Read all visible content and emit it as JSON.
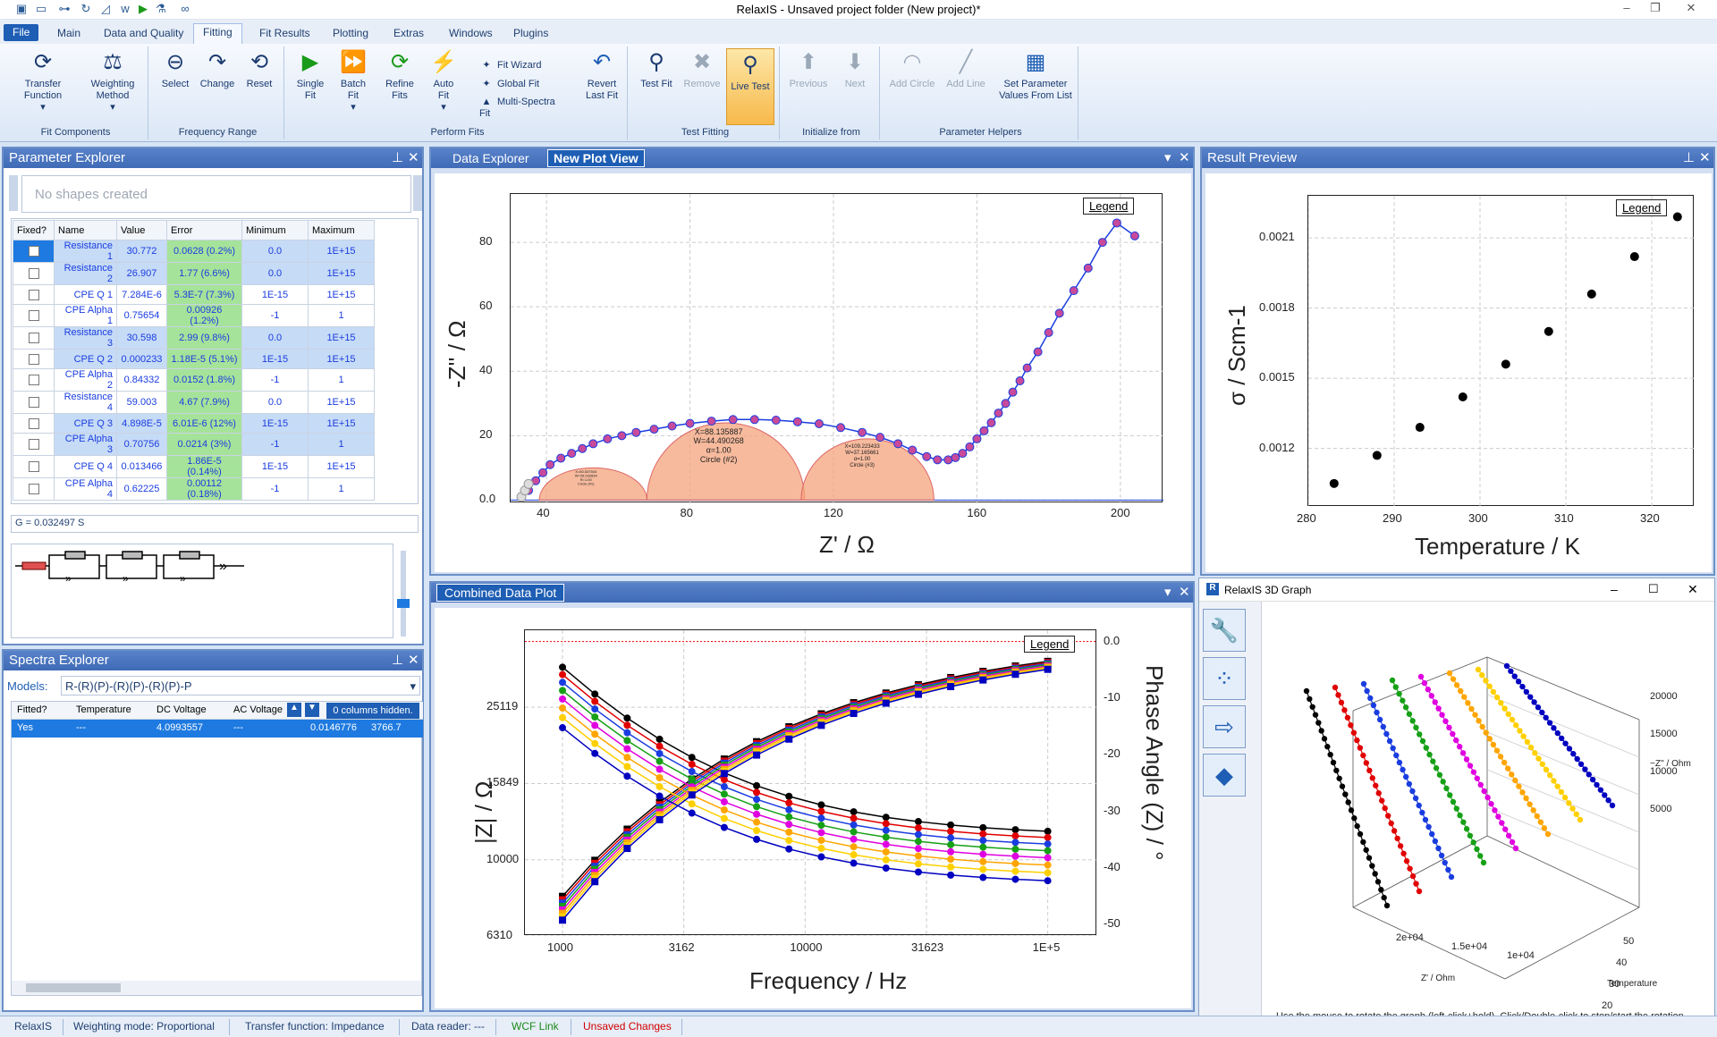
{
  "app": {
    "title": "RelaxIS - Unsaved project folder (New project)*"
  },
  "ribbon": {
    "tabs": [
      "File",
      "Main",
      "Data and Quality",
      "Fitting",
      "Fit Results",
      "Plotting",
      "Extras",
      "Windows",
      "Plugins"
    ],
    "active_tab": "Fitting",
    "groups": {
      "fit_components": {
        "label": "Fit Components",
        "transfer": "Transfer\nFunction",
        "weighting": "Weighting\nMethod"
      },
      "frequency_range": {
        "label": "Frequency Range",
        "select": "Select",
        "change": "Change",
        "reset": "Reset"
      },
      "perform_fits": {
        "label": "Perform Fits",
        "single": "Single\nFit",
        "batch": "Batch\nFit",
        "refine": "Refine\nFits",
        "auto": "Auto\nFit",
        "wizard": "Fit Wizard",
        "global": "Global Fit",
        "multi": "Multi-Spectra\nFit",
        "revert": "Revert\nLast Fit"
      },
      "test_fitting": {
        "label": "Test Fitting",
        "test": "Test Fit",
        "remove": "Remove",
        "live": "Live Test"
      },
      "initialize": {
        "label": "Initialize from",
        "previous": "Previous",
        "next": "Next"
      },
      "helpers": {
        "label": "Parameter Helpers",
        "circle": "Add Circle",
        "line": "Add Line",
        "setparam": "Set Parameter\nValues From List"
      }
    }
  },
  "param_explorer": {
    "title": "Parameter Explorer",
    "shapes_placeholder": "No shapes created",
    "columns": [
      "Fixed?",
      "Name",
      "Value",
      "Error",
      "Minimum",
      "Maximum"
    ],
    "rows": [
      {
        "name": "Resistance 1",
        "value": "30.772",
        "error": "0.0628 (0.2%)",
        "min": "0.0",
        "max": "1E+15"
      },
      {
        "name": "Resistance 2",
        "value": "26.907",
        "error": "1.77 (6.6%)",
        "min": "0.0",
        "max": "1E+15"
      },
      {
        "name": "CPE Q 1",
        "value": "7.284E-6",
        "error": "5.3E-7 (7.3%)",
        "min": "1E-15",
        "max": "1E+15"
      },
      {
        "name": "CPE Alpha 1",
        "value": "0.75654",
        "error": "0.00926 (1.2%)",
        "min": "-1",
        "max": "1"
      },
      {
        "name": "Resistance 3",
        "value": "30.598",
        "error": "2.99 (9.8%)",
        "min": "0.0",
        "max": "1E+15"
      },
      {
        "name": "CPE Q 2",
        "value": "0.000233",
        "error": "1.18E-5 (5.1%)",
        "min": "1E-15",
        "max": "1E+15"
      },
      {
        "name": "CPE Alpha 2",
        "value": "0.84332",
        "error": "0.0152 (1.8%)",
        "min": "-1",
        "max": "1"
      },
      {
        "name": "Resistance 4",
        "value": "59.003",
        "error": "4.67 (7.9%)",
        "min": "0.0",
        "max": "1E+15"
      },
      {
        "name": "CPE Q 3",
        "value": "4.898E-5",
        "error": "6.01E-6 (12%)",
        "min": "1E-15",
        "max": "1E+15"
      },
      {
        "name": "CPE Alpha 3",
        "value": "0.70756",
        "error": "0.0214 (3%)",
        "min": "-1",
        "max": "1"
      },
      {
        "name": "CPE Q 4",
        "value": "0.013466",
        "error": "1.86E-5 (0.14%)",
        "min": "1E-15",
        "max": "1E+15"
      },
      {
        "name": "CPE Alpha 4",
        "value": "0.62225",
        "error": "0.00112 (0.18%)",
        "min": "-1",
        "max": "1"
      }
    ],
    "g_value": "G = 0.032497 S"
  },
  "spectra_explorer": {
    "title": "Spectra Explorer",
    "models_label": "Models:",
    "model": "R-(R)(P)-(R)(P)-(R)(P)-P",
    "columns": [
      "Fitted?",
      "Temperature",
      "DC Voltage",
      "AC Voltage"
    ],
    "hidden_note": "0 columns hidden.",
    "row": {
      "fitted": "Yes",
      "temperature": "---",
      "dc": "4.0993557",
      "ac": "---",
      "c5": "0.0146776",
      "c6": "3766.7"
    }
  },
  "plot_tabs": {
    "data_explorer": "Data Explorer",
    "new_plot": "New Plot View"
  },
  "combined_tab": "Combined Data Plot",
  "result_preview": {
    "title": "Result Preview"
  },
  "graph3d": {
    "title": "RelaxIS 3D Graph",
    "hint": "Use the mouse to rotate the graph (left-click+hold). Click/Double-click to stop/start the rotation.",
    "z_ticks": [
      "20000",
      "15000",
      "10000",
      "5000"
    ],
    "z_label": "−Z'' / Ohm",
    "t_ticks": [
      "50",
      "40",
      "30",
      "20"
    ],
    "t_label": "Temperature",
    "x_ticks": [
      "2e+04",
      "1.5e+04",
      "1e+04"
    ],
    "x_label": "Z' / Ohm"
  },
  "legend_label": "Legend",
  "status": {
    "items": [
      "RelaxIS",
      "Weighting mode: Proportional",
      "Transfer function: Impedance",
      "Data reader: ---",
      "WCF Link",
      "Unsaved Changes"
    ]
  },
  "colors": {
    "accent": "#3f6ab6",
    "series": [
      "#000000",
      "#e00000",
      "#1a3de0",
      "#16a016",
      "#e000e0",
      "#ffa500",
      "#ffd000",
      "#0000c0"
    ]
  },
  "chart_data": [
    {
      "type": "scatter",
      "xlabel": "Z' / Ω",
      "ylabel": "-Z'' / Ω",
      "xlim": [
        30,
        212
      ],
      "ylim": [
        -1,
        95
      ],
      "x_ticks": [
        "40",
        "80",
        "120",
        "160",
        "200"
      ],
      "y_ticks": [
        "0.0",
        "20",
        "40",
        "60",
        "80"
      ],
      "series": [
        {
          "x": [
            35,
            37,
            39,
            41,
            44,
            47,
            50,
            53,
            57,
            61,
            65,
            70,
            75,
            80,
            86,
            92,
            98,
            104,
            110,
            116,
            122,
            128,
            133,
            138,
            142,
            146,
            149,
            152,
            154,
            156,
            158,
            160,
            162,
            164,
            166,
            168,
            170,
            172,
            174,
            177,
            180,
            183,
            187,
            191,
            195,
            199,
            204
          ],
          "y": [
            3,
            6,
            8.5,
            11,
            13,
            14.5,
            16,
            17.5,
            19,
            20,
            21,
            22,
            23,
            23.8,
            24.5,
            25,
            25,
            24.8,
            24.3,
            23.7,
            22.5,
            21,
            19.5,
            17.5,
            15.5,
            13.5,
            12.5,
            12.5,
            13.2,
            14.5,
            16.5,
            19,
            21.5,
            24,
            27,
            30,
            33.5,
            37,
            41,
            46,
            52,
            58,
            65,
            72,
            80,
            86,
            82
          ]
        }
      ],
      "circles": [
        {
          "label": "X=50.537503\nW=25.032834\nR=1.00\nCircle (#1)",
          "x": 51
        },
        {
          "label": "X=88.135887\nW=44.490268\nα=1.00\nCircle (#2)",
          "x": 88
        },
        {
          "label": "X=109.223433\nW=37.165661\nα=1.00\nCircle (#3)",
          "x": 128
        }
      ]
    },
    {
      "type": "scatter",
      "xlabel": "Temperature / K",
      "ylabel": "σ / Scm-1",
      "xlim": [
        280,
        325
      ],
      "ylim": [
        0.00095,
        0.00228
      ],
      "x_ticks": [
        "280",
        "290",
        "300",
        "310",
        "320"
      ],
      "y_ticks": [
        "0.0012",
        "0.0015",
        "0.0018",
        "0.0021"
      ],
      "series": [
        {
          "x": [
            283,
            288,
            293,
            298,
            303,
            308,
            313,
            318,
            323
          ],
          "y": [
            0.00105,
            0.00117,
            0.00129,
            0.00142,
            0.00156,
            0.0017,
            0.00186,
            0.00202,
            0.00219
          ]
        }
      ]
    },
    {
      "type": "line",
      "xlabel": "Frequency / Hz",
      "ylabel": "|Z| / Ω",
      "y2label": "Phase Angle (Z) / °",
      "xscale": "log",
      "xlim": [
        700,
        160000
      ],
      "x_ticks": [
        "1000",
        "3162",
        "10000",
        "31623",
        "1E+5"
      ],
      "y_ticks": [
        "6310",
        "10000",
        "15849",
        "25119"
      ],
      "y2_ticks": [
        "0.0",
        "-10",
        "-20",
        "-30",
        "-40",
        "-50"
      ]
    }
  ]
}
